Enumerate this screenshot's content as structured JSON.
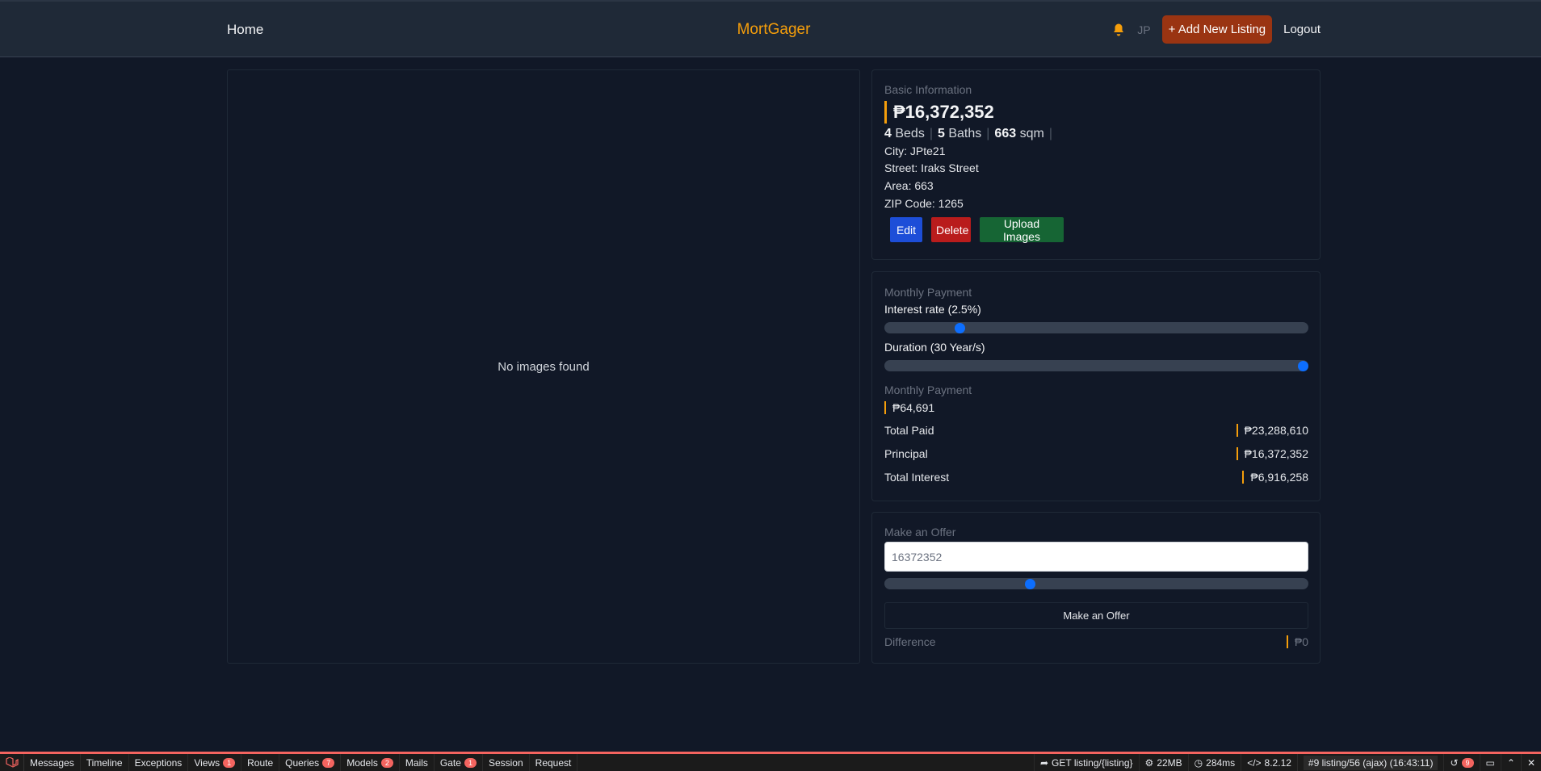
{
  "nav": {
    "home": "Home",
    "brand": "MortGager",
    "initials": "JP",
    "add_listing": "+ Add New Listing",
    "logout": "Logout"
  },
  "images": {
    "empty_text": "No images found"
  },
  "basic": {
    "title": "Basic Information",
    "price": "₱16,372,352",
    "beds_num": "4",
    "beds_label": "Beds",
    "baths_num": "5",
    "baths_label": "Baths",
    "area_num": "663",
    "area_label": "sqm",
    "city": "City: JPte21",
    "street": "Street: Iraks Street",
    "area": "Area: 663",
    "zip": "ZIP Code: 1265",
    "edit": "Edit",
    "delete": "Delete",
    "upload": "Upload Images"
  },
  "monthly": {
    "title": "Monthly Payment",
    "interest_label": "Interest rate (2.5%)",
    "interest_fraction": 0.17,
    "duration_label": "Duration (30 Year/s)",
    "duration_fraction": 1.0,
    "payment_label": "Monthly Payment",
    "payment_value": "₱64,691",
    "total_paid_label": "Total Paid",
    "total_paid_value": "₱23,288,610",
    "principal_label": "Principal",
    "principal_value": "₱16,372,352",
    "total_interest_label": "Total Interest",
    "total_interest_value": "₱6,916,258"
  },
  "offer": {
    "title": "Make an Offer",
    "input_value": "16372352",
    "slider_fraction": 0.34,
    "button": "Make an Offer",
    "difference_label": "Difference",
    "difference_value": "₱0"
  },
  "debugbar": {
    "tabs": [
      {
        "label": "Messages",
        "badge": ""
      },
      {
        "label": "Timeline",
        "badge": ""
      },
      {
        "label": "Exceptions",
        "badge": ""
      },
      {
        "label": "Views",
        "badge": "1"
      },
      {
        "label": "Route",
        "badge": ""
      },
      {
        "label": "Queries",
        "badge": "7"
      },
      {
        "label": "Models",
        "badge": "2"
      },
      {
        "label": "Mails",
        "badge": ""
      },
      {
        "label": "Gate",
        "badge": "1"
      },
      {
        "label": "Session",
        "badge": ""
      },
      {
        "label": "Request",
        "badge": ""
      }
    ],
    "route": "GET listing/{listing}",
    "memory": "22MB",
    "time": "284ms",
    "php": "8.2.12",
    "request_select": "#9 listing/56 (ajax) (16:43:11)",
    "history_badge": "9"
  },
  "colors": {
    "accent": "#f59e0b",
    "add_button": "#9a3412",
    "slider_thumb": "#0d6efd"
  }
}
